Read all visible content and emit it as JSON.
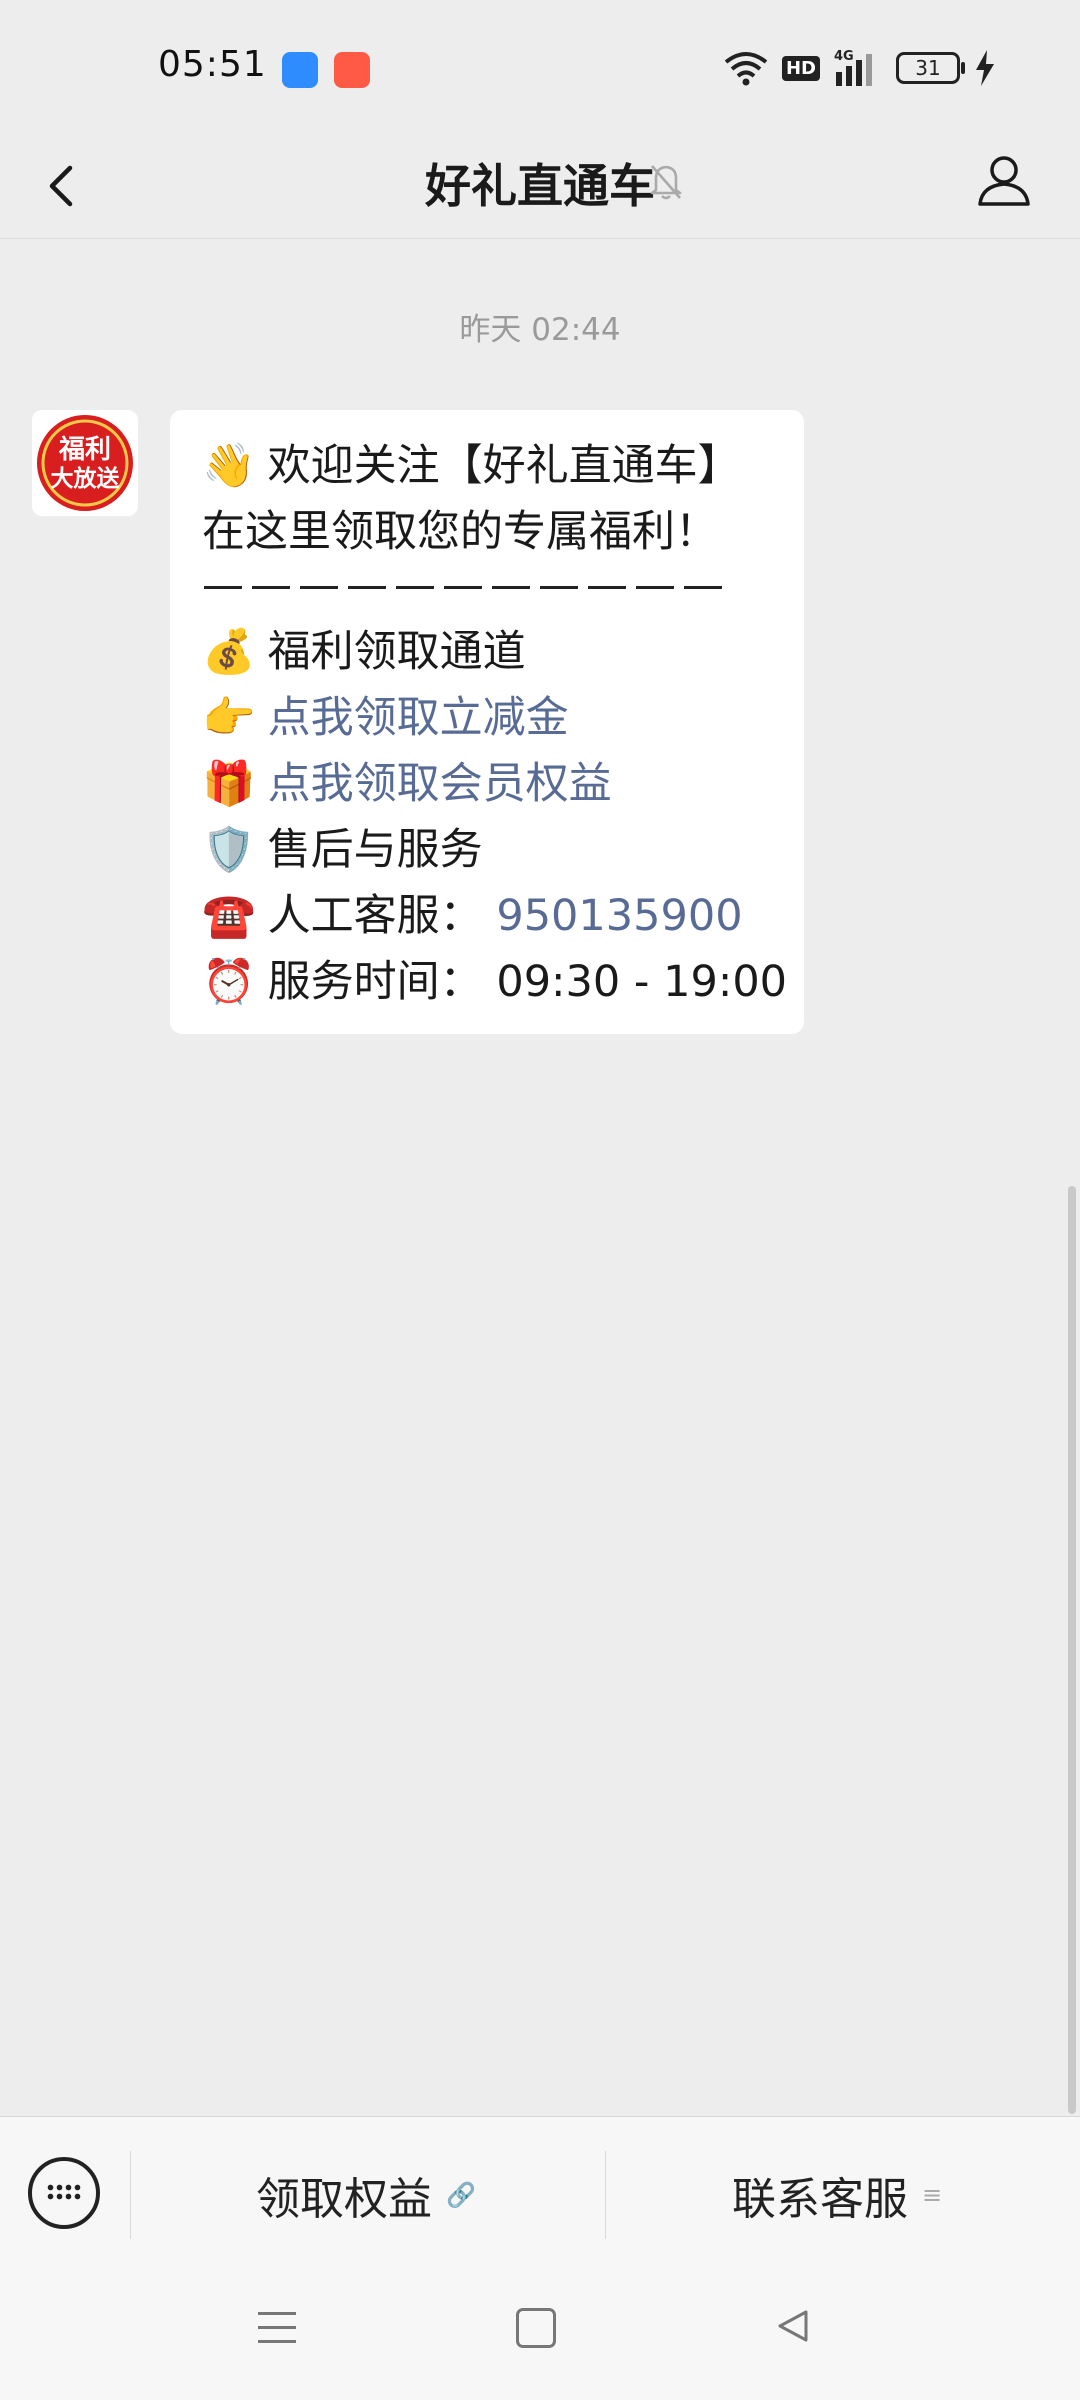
{
  "status_bar": {
    "time": "05:51",
    "hd": "HD",
    "network": "4G",
    "battery": "31"
  },
  "header": {
    "title": "好礼直通车"
  },
  "chat": {
    "timestamp": "昨天 02:44",
    "avatar_lettering": "福利大放送",
    "message": {
      "line1": {
        "emoji": "👋",
        "text": "欢迎关注【好礼直通车】"
      },
      "line2": {
        "text": "在这里领取您的专属福利！"
      },
      "line3": {
        "emoji": "💰",
        "text": "福利领取通道"
      },
      "line4": {
        "emoji": "👉",
        "text": "点我领取立减金"
      },
      "line5": {
        "emoji": "🎁",
        "text": "点我领取会员权益"
      },
      "line6": {
        "emoji": "🛡️",
        "text": "售后与服务"
      },
      "line7": {
        "emoji": "☎️",
        "label": "人工客服：",
        "phone": "950135900"
      },
      "line8": {
        "emoji": "⏰",
        "label": "服务时间：",
        "hours": "09:30 - 19:00"
      }
    },
    "link_color": "#576b95"
  },
  "bottom_menu": {
    "items": [
      {
        "label": "领取权益",
        "icon": "link-icon"
      },
      {
        "label": "联系客服",
        "icon": "menu-lines-icon"
      }
    ]
  },
  "icons": [
    "back-arrow-icon",
    "mute-bell-icon",
    "profile-icon",
    "keyboard-icon",
    "wifi-icon",
    "signal-icon",
    "battery-icon",
    "charging-icon"
  ]
}
